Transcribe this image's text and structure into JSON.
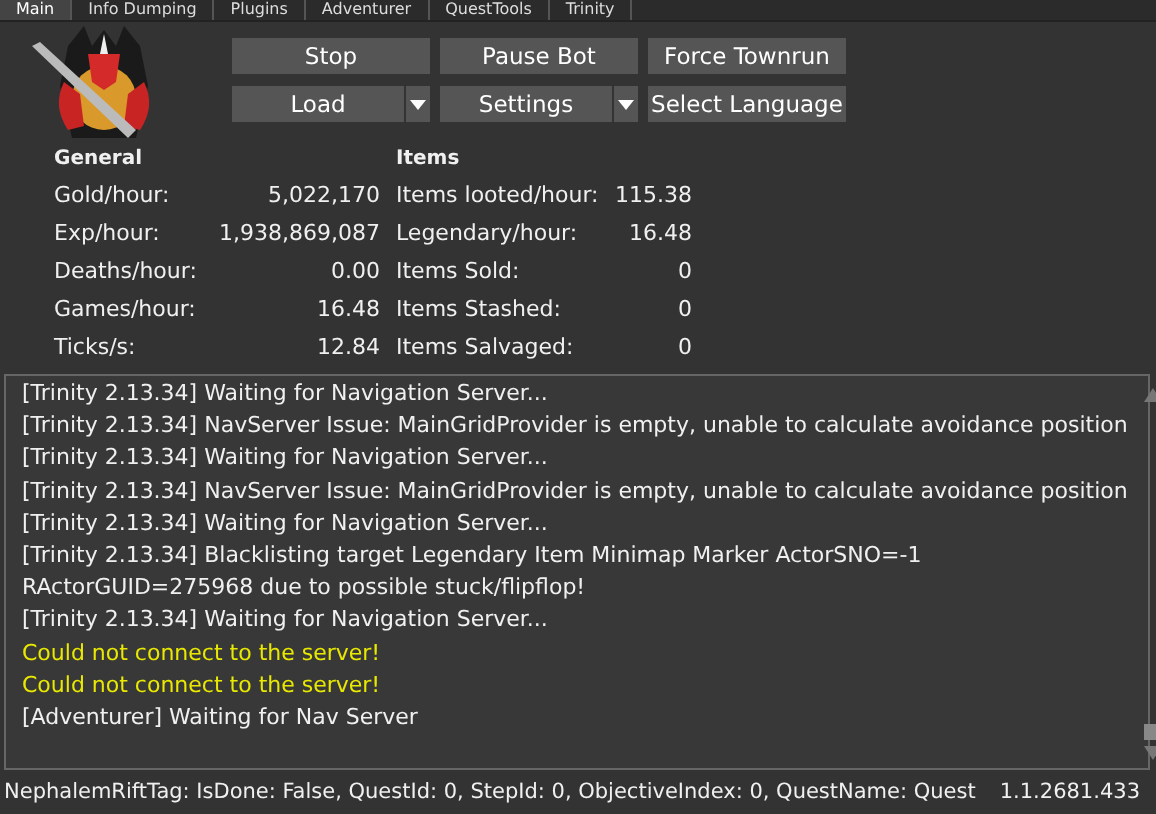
{
  "tabs": [
    {
      "label": "Main",
      "selected": true
    },
    {
      "label": "Info Dumping",
      "selected": false
    },
    {
      "label": "Plugins",
      "selected": false
    },
    {
      "label": "Adventurer",
      "selected": false
    },
    {
      "label": "QuestTools",
      "selected": false
    },
    {
      "label": "Trinity",
      "selected": false
    }
  ],
  "buttons": [
    {
      "label": "Stop",
      "dropdown": false
    },
    {
      "label": "Pause Bot",
      "dropdown": false
    },
    {
      "label": "Force Townrun",
      "dropdown": false
    },
    {
      "label": "Load",
      "dropdown": true
    },
    {
      "label": "Settings",
      "dropdown": true
    },
    {
      "label": "Select Language",
      "dropdown": false
    }
  ],
  "stats": [
    {
      "title": "General",
      "rows": [
        {
          "label": "Gold/hour:",
          "value": "5,022,170"
        },
        {
          "label": "Exp/hour:",
          "value": "1,938,869,087"
        },
        {
          "label": "Deaths/hour:",
          "value": "0.00"
        },
        {
          "label": "Games/hour:",
          "value": "16.48"
        },
        {
          "label": "Ticks/s:",
          "value": "12.84"
        }
      ]
    },
    {
      "title": "Items",
      "rows": [
        {
          "label": "Items looted/hour:",
          "value": "115.38"
        },
        {
          "label": "Legendary/hour:",
          "value": "16.48"
        },
        {
          "label": "Items Sold:",
          "value": "0"
        },
        {
          "label": "Items Stashed:",
          "value": "0"
        },
        {
          "label": "Items Salvaged:",
          "value": "0"
        }
      ]
    }
  ],
  "log": [
    {
      "text": "[Trinity 2.13.34] Waiting for Navigation Server...",
      "kind": "info"
    },
    {
      "text": "[Trinity 2.13.34] NavServer Issue: MainGridProvider is empty, unable to calculate avoidance position",
      "kind": "info"
    },
    {
      "text": "[Trinity 2.13.34] Waiting for Navigation Server...",
      "kind": "info"
    },
    {
      "text": "[Trinity 2.13.34] NavServer Issue: MainGridProvider is empty, unable to calculate avoidance position",
      "kind": "info"
    },
    {
      "text": "[Trinity 2.13.34] Waiting for Navigation Server...",
      "kind": "info"
    },
    {
      "text": "[Trinity 2.13.34] Blacklisting target Legendary Item Minimap Marker ActorSNO=-1",
      "kind": "info"
    },
    {
      "text": "RActorGUID=275968 due to possible stuck/flipflop!",
      "kind": "info"
    },
    {
      "text": "[Trinity 2.13.34] Waiting for Navigation Server...",
      "kind": "info"
    },
    {
      "text": "Could not connect to the server!",
      "kind": "warning"
    },
    {
      "text": "Could not connect to the server!",
      "kind": "warning"
    },
    {
      "text": "[Adventurer] Waiting for Nav Server",
      "kind": "info"
    }
  ],
  "status_bar": {
    "message": "NephalemRiftTag: IsDone: False, QuestId: 0, StepId: 0, ObjectiveIndex: 0, QuestName: Quest",
    "version": "1.1.2681.433"
  }
}
